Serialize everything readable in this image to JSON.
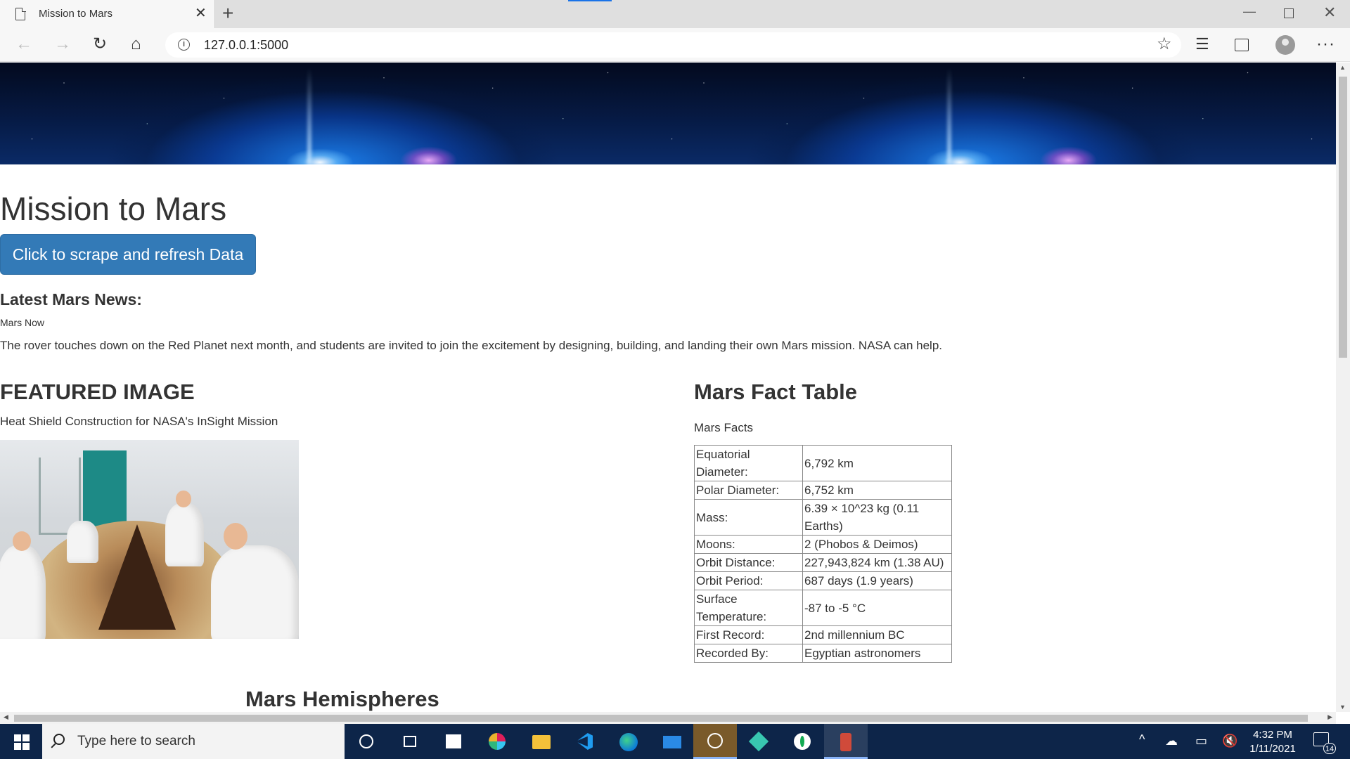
{
  "browser": {
    "tab_title": "Mission to Mars",
    "new_tab_glyph": "+",
    "url": "127.0.0.1:5000"
  },
  "page": {
    "title": "Mission to Mars",
    "scrape_button": "Click to scrape and refresh Data",
    "news": {
      "heading": "Latest Mars News:",
      "title": "Mars Now",
      "paragraph": "The rover touches down on the Red Planet next month, and students are invited to join the excitement by designing, building, and landing their own Mars mission. NASA can help."
    },
    "featured": {
      "heading": "FEATURED IMAGE",
      "caption": "Heat Shield Construction for NASA's InSight Mission"
    },
    "facts": {
      "heading": "Mars Fact Table",
      "subheading": "Mars Facts",
      "rows": [
        {
          "label": "Equatorial Diameter:",
          "value": "6,792 km"
        },
        {
          "label": "Polar Diameter:",
          "value": "6,752 km"
        },
        {
          "label": "Mass:",
          "value": "6.39 × 10^23 kg (0.11 Earths)"
        },
        {
          "label": "Moons:",
          "value": "2 (Phobos & Deimos)"
        },
        {
          "label": "Orbit Distance:",
          "value": "227,943,824 km (1.38 AU)"
        },
        {
          "label": "Orbit Period:",
          "value": "687 days (1.9 years)"
        },
        {
          "label": "Surface Temperature:",
          "value": "-87 to -5 °C"
        },
        {
          "label": "First Record:",
          "value": "2nd millennium BC"
        },
        {
          "label": "Recorded By:",
          "value": "Egyptian astronomers"
        }
      ]
    },
    "hemispheres": {
      "heading": "Mars Hemispheres"
    }
  },
  "taskbar": {
    "search_placeholder": "Type here to search",
    "time": "4:32 PM",
    "date": "1/11/2021",
    "notification_count": "14",
    "apps": [
      "cortana-icon",
      "task-view-icon",
      "store-icon",
      "slack-icon",
      "file-explorer-icon",
      "vscode-icon",
      "edge-icon",
      "mail-icon",
      "todo-icon",
      "gitkraken-icon",
      "mongodb-icon",
      "app-icon"
    ]
  },
  "colors": {
    "button_bg": "#337ab7",
    "taskbar_bg": "#0d2549",
    "accent": "#1a73e8"
  }
}
